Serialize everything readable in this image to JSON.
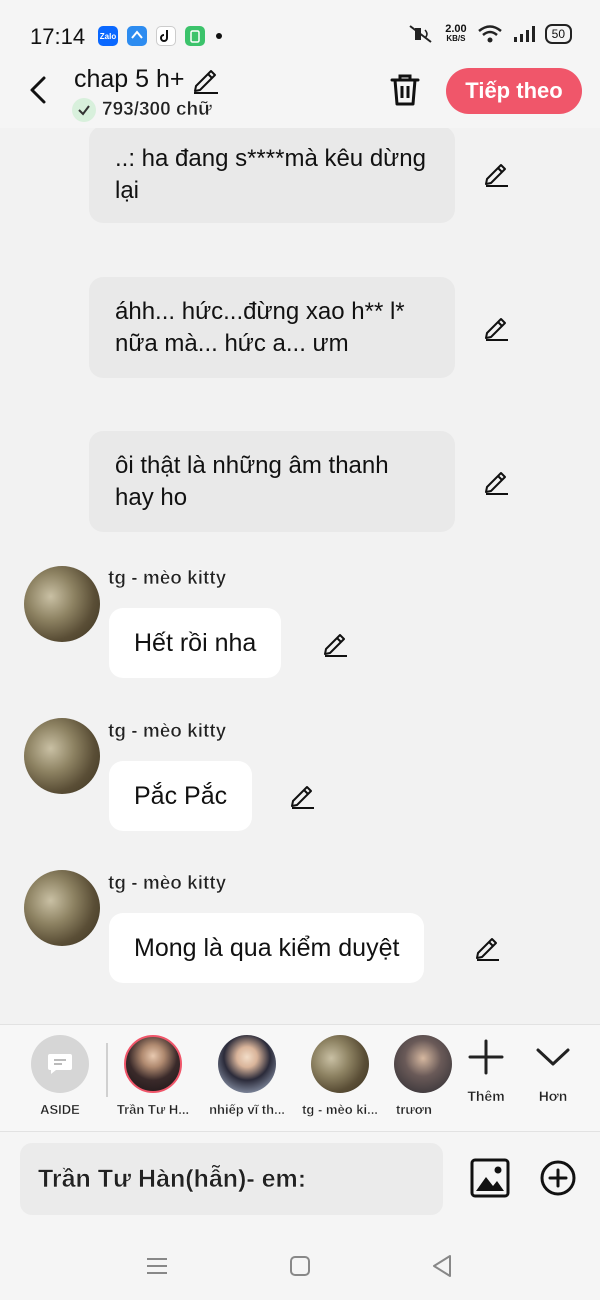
{
  "status": {
    "time": "17:14",
    "apps": [
      "Zalo",
      "messenger-icon",
      "tiktok-icon",
      "battery-saver-icon"
    ],
    "net_speed": "2.00",
    "net_unit": "KB/S",
    "battery": "50"
  },
  "header": {
    "title": "chap 5 h+",
    "word_count": "793/300 chữ",
    "next_label": "Tiếp theo"
  },
  "narration": [
    {
      "text": "..: ha đang s****mà kêu dừng lại"
    },
    {
      "text": "áhh... hức...đừng xao h** l* nữa mà... hức a... ưm"
    },
    {
      "text": "ôi thật là những âm thanh hay ho"
    }
  ],
  "messages": [
    {
      "speaker": "tg - mèo kitty",
      "text": "Hết rồi nha"
    },
    {
      "speaker": "tg - mèo kitty",
      "text": "Pắc Pắc"
    },
    {
      "speaker": "tg - mèo kitty",
      "text": "Mong là qua kiểm duyệt"
    }
  ],
  "characters": [
    {
      "name": "ASIDE"
    },
    {
      "name": "Trần Tư H..."
    },
    {
      "name": "nhiếp vĩ th..."
    },
    {
      "name": "tg - mèo ki..."
    },
    {
      "name": "trươn"
    }
  ],
  "actions": {
    "add_label": "Thêm",
    "more_label": "Hơn"
  },
  "input": {
    "text": "Trần Tư Hàn(hẫn)- em:"
  },
  "colors": {
    "accent": "#f0566a",
    "bubble_narr": "#e9e9e9",
    "bubble_msg": "#ffffff"
  }
}
